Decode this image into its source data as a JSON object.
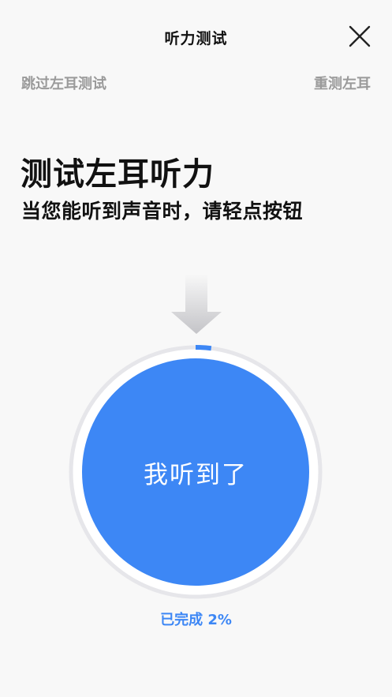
{
  "header": {
    "title": "听力测试",
    "close_icon": "close-icon"
  },
  "links": {
    "skip": "跳过左耳测试",
    "retest": "重测左耳"
  },
  "main": {
    "heading": "测试左耳听力",
    "instruction": "当您能听到声音时，请轻点按钮",
    "arrow_icon": "down-arrow-icon",
    "button_label": "我听到了",
    "progress_fraction": 0.02,
    "progress_text": "已完成 2%"
  },
  "colors": {
    "accent": "#3d87f5",
    "ring_track": "#e6e6ea",
    "link_gray": "#9a9a9a",
    "background": "#f8f8f8"
  }
}
